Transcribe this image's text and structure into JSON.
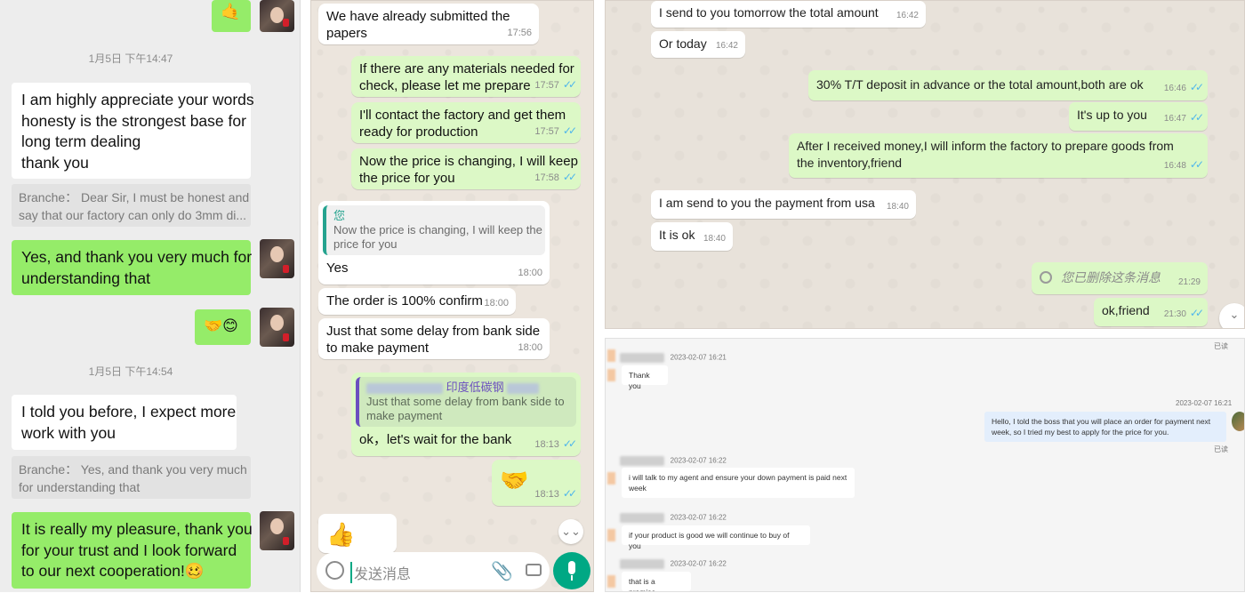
{
  "wechat": {
    "emoji_top": "🤙",
    "time1": "1月5日 下午14:47",
    "msg1_lines": [
      "I am highly appreciate your words",
      "honesty is the strongest base for",
      "long term dealing",
      "thank you"
    ],
    "quote1_lines": [
      "Branche：  Dear Sir, I must be honest and",
      "say that our factory can only do 3mm di..."
    ],
    "msg2_lines": [
      "Yes, and thank you very much for",
      "understanding that"
    ],
    "msg3": "🤝😊",
    "time2": "1月5日 下午14:54",
    "msg4_lines": [
      "I told you before, I expect more",
      "work with you"
    ],
    "quote2_lines": [
      "Branche：  Yes, and thank you very much",
      "for understanding that"
    ],
    "msg5_lines": [
      "It is really my pleasure, thank you",
      "for your trust and I look forward",
      "to our next cooperation!🥴"
    ]
  },
  "whatsapp": {
    "m1_lines": [
      "We have already submitted the",
      "papers"
    ],
    "m1_time": "17:56",
    "m2_lines": [
      "If there are any materials needed for",
      "check, please let me prepare"
    ],
    "m2_time": "17:57",
    "m3_lines": [
      "I'll contact the factory and get them",
      "ready for production"
    ],
    "m3_time": "17:57",
    "m4_lines": [
      "Now the price is changing, I will keep",
      "the  price for you"
    ],
    "m4_time": "17:58",
    "m5_quote_name": "您",
    "m5_quote_lines": [
      "Now the price is changing, I will keep the",
      "price for you"
    ],
    "m5_text": "Yes",
    "m5_time": "18:00",
    "m6_text": "The order is 100% confirm",
    "m6_time": "18:00",
    "m7_lines": [
      "Just that some delay from bank side",
      "to make payment"
    ],
    "m7_time": "18:00",
    "m8_quote_name": "印度低碳钢",
    "m8_quote_lines": [
      "Just that some delay from bank side to",
      "make payment"
    ],
    "m8_text": "ok，let's wait for the bank",
    "m8_time": "18:13",
    "m9_emoji": "🤝",
    "m9_time": "18:13",
    "m10_emoji": "👍",
    "input_placeholder": "发送消息"
  },
  "whatsapp_web": {
    "r1_text": "I send to you tomorrow the total amount",
    "r1_time": "16:42",
    "r2_text": "Or today",
    "r2_time": "16:42",
    "s1_text": "30% T/T deposit in advance or the total amount,both are ok",
    "s1_time": "16:46",
    "s2_text": "It's up to you",
    "s2_time": "16:47",
    "s3_lines": [
      "After I received money,I will inform the factory to prepare goods from",
      "the inventory,friend"
    ],
    "s3_time": "16:48",
    "r3_text": "I am send to you the payment from usa",
    "r3_time": "18:40",
    "r4_text": "It is ok",
    "r4_time": "18:40",
    "s4_text": "您已删除这条消息",
    "s4_time": "21:29",
    "s5_text": "ok,friend",
    "s5_time": "21:30"
  },
  "web_chat": {
    "read_top": "已读",
    "in1_time": "2023-02-07 16:21",
    "in1_text": "Thank you",
    "out1_time": "2023-02-07 16:21",
    "out1_lines": [
      "Hello, I told the boss that you will place an order for payment next",
      "week, so I tried my best to apply for the price for you."
    ],
    "out1_read": "已读",
    "in2_time": "2023-02-07 16:22",
    "in2_lines": [
      "i will talk to my agent and ensure your down payment is paid next",
      "week"
    ],
    "in3_time": "2023-02-07 16:22",
    "in3_text": "if your product is good we will continue to buy of you",
    "in4_time": "2023-02-07 16:22",
    "in4_text": "that is a promise"
  }
}
